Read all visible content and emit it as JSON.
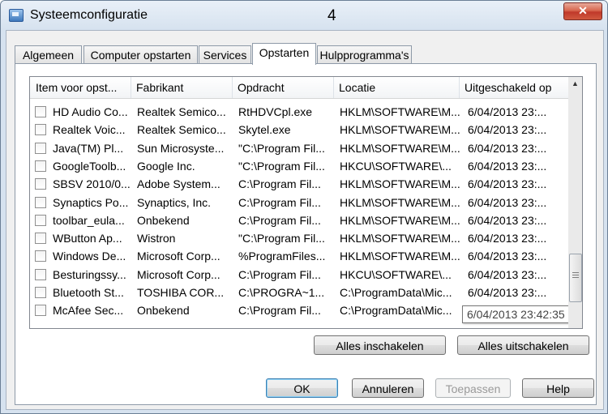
{
  "window": {
    "title": "Systeemconfiguratie",
    "annotation": "4",
    "close_glyph": "✕"
  },
  "tabs": [
    "Algemeen",
    "Computer opstarten",
    "Services",
    "Opstarten",
    "Hulpprogramma's"
  ],
  "active_tab": "Opstarten",
  "table": {
    "columns": [
      "Item voor opst...",
      "Fabrikant",
      "Opdracht",
      "Locatie",
      "Uitgeschakeld op"
    ],
    "rows": [
      [
        "HD Audio Co...",
        "Realtek Semico...",
        "RtHDVCpl.exe",
        "HKLM\\SOFTWARE\\M...",
        "6/04/2013 23:..."
      ],
      [
        "Realtek Voic...",
        "Realtek Semico...",
        "Skytel.exe",
        "HKLM\\SOFTWARE\\M...",
        "6/04/2013 23:..."
      ],
      [
        "Java(TM) Pl...",
        "Sun Microsyste...",
        "\"C:\\Program Fil...",
        "HKLM\\SOFTWARE\\M...",
        "6/04/2013 23:..."
      ],
      [
        "GoogleToolb...",
        "Google Inc.",
        "\"C:\\Program Fil...",
        "HKCU\\SOFTWARE\\...",
        "6/04/2013 23:..."
      ],
      [
        "SBSV 2010/0...",
        "Adobe System...",
        "C:\\Program Fil...",
        "HKLM\\SOFTWARE\\M...",
        "6/04/2013 23:..."
      ],
      [
        "Synaptics Po...",
        "Synaptics, Inc.",
        "C:\\Program Fil...",
        "HKLM\\SOFTWARE\\M...",
        "6/04/2013 23:..."
      ],
      [
        "toolbar_eula...",
        "Onbekend",
        "C:\\Program Fil...",
        "HKLM\\SOFTWARE\\M...",
        "6/04/2013 23:..."
      ],
      [
        "WButton Ap...",
        "Wistron",
        "\"C:\\Program Fil...",
        "HKLM\\SOFTWARE\\M...",
        "6/04/2013 23:..."
      ],
      [
        "Windows De...",
        "Microsoft Corp...",
        "%ProgramFiles...",
        "HKLM\\SOFTWARE\\M...",
        "6/04/2013 23:..."
      ],
      [
        "Besturingssy...",
        "Microsoft Corp...",
        "C:\\Program Fil...",
        "HKCU\\SOFTWARE\\...",
        "6/04/2013 23:..."
      ],
      [
        "Bluetooth St...",
        "TOSHIBA COR...",
        "C:\\PROGRA~1...",
        "C:\\ProgramData\\Mic...",
        "6/04/2013 23:..."
      ],
      [
        "McAfee Sec...",
        "Onbekend",
        "C:\\Program Fil...",
        "C:\\ProgramData\\Mic...",
        ""
      ]
    ],
    "tooltip": "6/04/2013 23:42:35"
  },
  "buttons": {
    "enable_all": "Alles inschakelen",
    "disable_all": "Alles uitschakelen",
    "ok": "OK",
    "cancel": "Annuleren",
    "apply": "Toepassen",
    "help": "Help"
  }
}
